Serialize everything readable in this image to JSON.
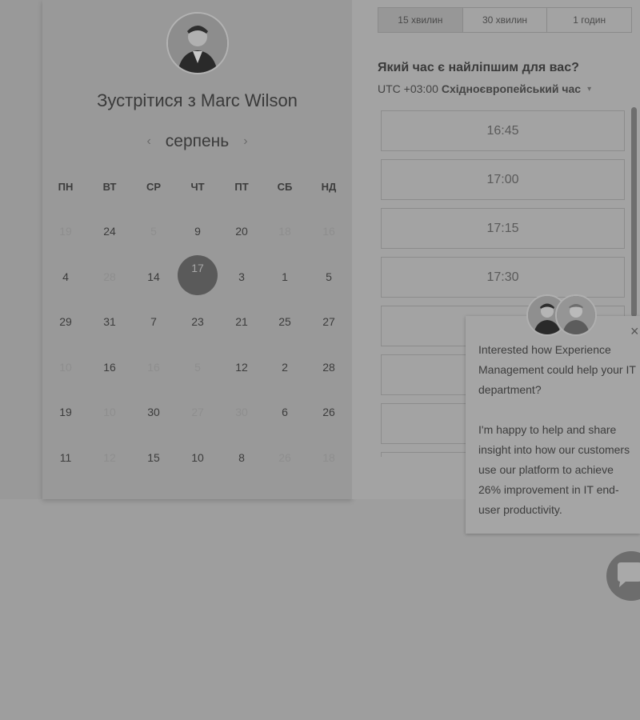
{
  "meeting": {
    "title": "Зустрітися з Marc Wilson"
  },
  "calendar": {
    "month": "серпень",
    "prev_icon": "‹",
    "next_icon": "›",
    "weekdays": [
      "ПН",
      "ВТ",
      "СР",
      "ЧТ",
      "ПТ",
      "СБ",
      "НД"
    ],
    "weeks": [
      [
        {
          "d": "19",
          "muted": true
        },
        {
          "d": "24"
        },
        {
          "d": "5",
          "muted": true
        },
        {
          "d": "9"
        },
        {
          "d": "20"
        },
        {
          "d": "18",
          "muted": true
        },
        {
          "d": "16",
          "muted": true
        }
      ],
      [
        {
          "d": "4"
        },
        {
          "d": "28",
          "muted": true
        },
        {
          "d": "14"
        },
        {
          "d": "17",
          "selected": true
        },
        {
          "d": "3"
        },
        {
          "d": "1"
        },
        {
          "d": "5"
        }
      ],
      [
        {
          "d": "29"
        },
        {
          "d": "31"
        },
        {
          "d": "7"
        },
        {
          "d": "23"
        },
        {
          "d": "21"
        },
        {
          "d": "25"
        },
        {
          "d": "27"
        }
      ],
      [
        {
          "d": "10",
          "muted": true
        },
        {
          "d": "16"
        },
        {
          "d": "16",
          "muted": true
        },
        {
          "d": "5",
          "muted": true
        },
        {
          "d": "12"
        },
        {
          "d": "2"
        },
        {
          "d": "28"
        }
      ],
      [
        {
          "d": "19"
        },
        {
          "d": "10",
          "muted": true
        },
        {
          "d": "30"
        },
        {
          "d": "27",
          "muted": true
        },
        {
          "d": "30",
          "muted": true
        },
        {
          "d": "6"
        },
        {
          "d": "26"
        }
      ],
      [
        {
          "d": "11"
        },
        {
          "d": "12",
          "muted": true
        },
        {
          "d": "15"
        },
        {
          "d": "10"
        },
        {
          "d": "8"
        },
        {
          "d": "26",
          "muted": true
        },
        {
          "d": "18",
          "muted": true
        }
      ]
    ]
  },
  "durations": [
    {
      "label": "15 хвилин",
      "active": true
    },
    {
      "label": "30 хвилин"
    },
    {
      "label": "1 годин"
    }
  ],
  "time_question": "Який час є найліпшим для вас?",
  "timezone": {
    "offset": "UTC +03:00",
    "name": "Східноєвропейський час",
    "caret": "▾"
  },
  "time_slots": [
    "16:45",
    "17:00",
    "17:15",
    "17:30",
    "",
    "",
    "",
    ""
  ],
  "chat": {
    "message_1": "Interested how Experience Management could help your IT department?",
    "message_2": "I'm happy to help and share insight into how our customers use our platform to achieve 26% improvement in IT end-user productivity.",
    "close_icon": "×"
  }
}
